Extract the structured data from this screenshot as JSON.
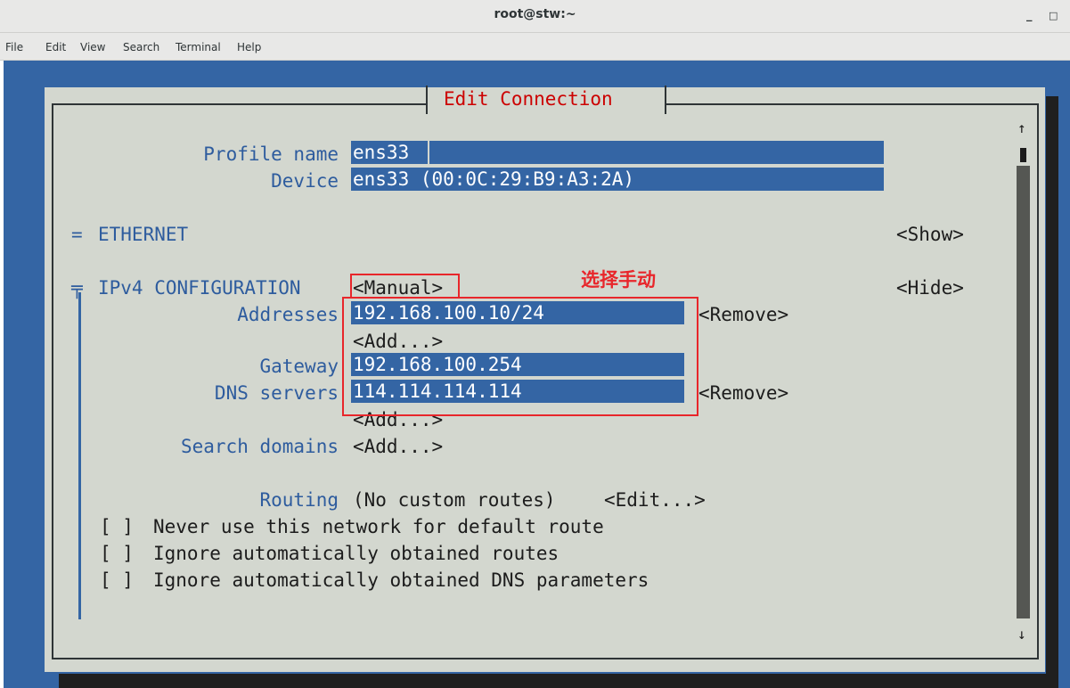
{
  "window": {
    "title": "root@stw:~",
    "minimize": "_",
    "maximize": "□"
  },
  "menu": [
    "File",
    "Edit",
    "View",
    "Search",
    "Terminal",
    "Help"
  ],
  "dialog": {
    "title": "Edit Connection",
    "profile_name_label": "Profile name",
    "profile_name": "ens33",
    "device_label": "Device",
    "device": "ens33 (00:0C:29:B9:A3:2A)",
    "ethernet_marker": "=",
    "ethernet_label": "ETHERNET",
    "ethernet_toggle": "<Show>",
    "ipv4_marker": "╤",
    "ipv4_label": "IPv4 CONFIGURATION",
    "ipv4_method": "<Manual>",
    "ipv4_toggle": "<Hide>",
    "addresses_label": "Addresses",
    "address": "192.168.100.10/24",
    "remove_label": "<Remove>",
    "add_label": "<Add...>",
    "gateway_label": "Gateway",
    "gateway": "192.168.100.254",
    "dns_label": "DNS servers",
    "dns": "114.114.114.114",
    "search_domains_label": "Search domains",
    "routing_label": "Routing",
    "routing_value": "(No custom routes)",
    "routing_edit": "<Edit...>",
    "checkbox": "[ ]",
    "check1": "Never use this network for default route",
    "check2": "Ignore automatically obtained routes",
    "check3": "Ignore automatically obtained DNS parameters"
  },
  "annotation": "选择手动",
  "scrollbar": {
    "up": "↑",
    "down": "↓"
  }
}
